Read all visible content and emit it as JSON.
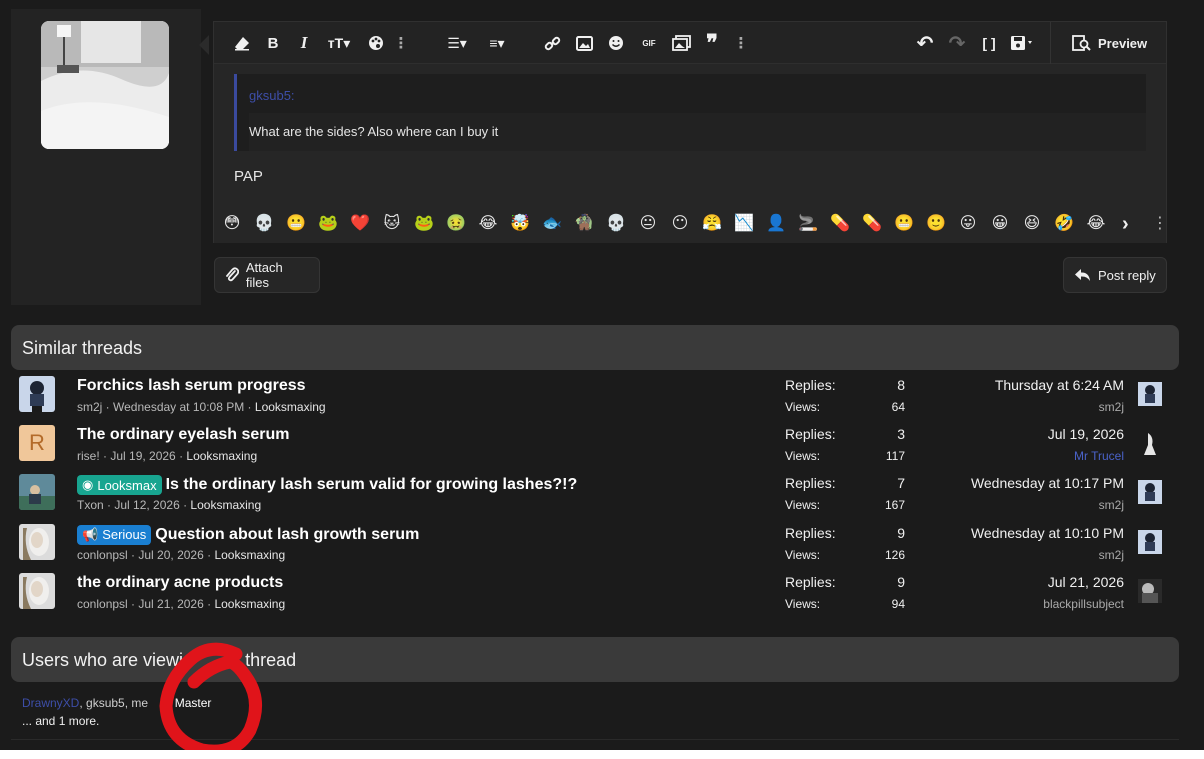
{
  "editor": {
    "quote_author": "gksub5:",
    "quote_text": "What are the sides? Also where can I buy it",
    "body_text": "PAP",
    "preview_label": "Preview",
    "attach_label": "Attach files",
    "post_reply_label": "Post reply",
    "toolbar_left": [
      {
        "icon": "eraser-icon",
        "glyph": "⌫"
      },
      {
        "icon": "bold-icon",
        "glyph": "B"
      },
      {
        "icon": "italic-icon",
        "glyph": "I"
      },
      {
        "icon": "text-size-icon",
        "glyph": "тT"
      },
      {
        "icon": "palette-icon",
        "glyph": "◕"
      },
      {
        "icon": "more-vertical-icon",
        "glyph": "⋮"
      },
      {
        "icon": "list-icon",
        "glyph": "☰"
      },
      {
        "icon": "align-icon",
        "glyph": "≡"
      },
      {
        "icon": "link-icon",
        "glyph": "🔗"
      },
      {
        "icon": "image-icon",
        "glyph": "▣"
      },
      {
        "icon": "smiley-icon",
        "glyph": "☺"
      },
      {
        "icon": "gif-icon",
        "glyph": "GIF"
      },
      {
        "icon": "media-icon",
        "glyph": "▦"
      },
      {
        "icon": "quote-icon",
        "glyph": "❞"
      },
      {
        "icon": "more-vertical-icon-2",
        "glyph": "⋮"
      }
    ],
    "toolbar_right": [
      {
        "icon": "undo-icon",
        "glyph": "↶"
      },
      {
        "icon": "redo-icon",
        "glyph": "↷"
      },
      {
        "icon": "bbcode-icon",
        "glyph": "[ ]"
      },
      {
        "icon": "save-draft-icon",
        "glyph": "▾"
      }
    ]
  },
  "smilies": [
    "😳",
    "💀",
    "😬",
    "🐸",
    "❤️",
    "🐱",
    "🐸",
    "🤢",
    "😂",
    "🤯",
    "🐟",
    "🧌",
    "💀",
    "😐",
    "😶",
    "😤",
    "📉",
    "👤",
    "🚬",
    "💊",
    "💊",
    "😬",
    "🙂",
    "😛",
    "😀",
    "😆",
    "🤣",
    "😂"
  ],
  "similar_threads": {
    "title": "Similar threads",
    "replies_label": "Replies:",
    "views_label": "Views:",
    "rows": [
      {
        "title": "Forchics lash serum progress",
        "label": "",
        "author": "sm2j",
        "date": "Wednesday at 10:08 PM",
        "forum": "Looksmaxing",
        "replies": "8",
        "views": "64",
        "last_date": "Thursday at 6:24 AM",
        "last_user": "sm2j",
        "avatar": "figure"
      },
      {
        "title": "The ordinary eyelash serum",
        "label": "",
        "author": "rise!",
        "date": "Jul 19, 2026",
        "forum": "Looksmaxing",
        "replies": "3",
        "views": "117",
        "last_date": "Jul 19, 2026",
        "last_user": "Mr Trucel",
        "avatar": "letter",
        "avatar_letter": "R"
      },
      {
        "title": "Is the ordinary lash serum valid for growing lashes?!?",
        "label": "Looksmax",
        "author": "Txon",
        "date": "Jul 12, 2026",
        "forum": "Looksmaxing",
        "replies": "7",
        "views": "167",
        "last_date": "Wednesday at 10:17 PM",
        "last_user": "sm2j",
        "avatar": "photo"
      },
      {
        "title": "Question about lash growth serum",
        "label": "Serious",
        "author": "conlonpsl",
        "date": "Jul 20, 2026",
        "forum": "Looksmaxing",
        "replies": "9",
        "views": "126",
        "last_date": "Wednesday at 10:10 PM",
        "last_user": "sm2j",
        "avatar": "face"
      },
      {
        "title": "the ordinary acne products",
        "label": "",
        "author": "conlonpsl",
        "date": "Jul 21, 2026",
        "forum": "Looksmaxing",
        "replies": "9",
        "views": "94",
        "last_date": "Jul 21, 2026",
        "last_user": "blackpillsubject",
        "avatar": "face"
      }
    ]
  },
  "viewers": {
    "title_left": "Users who are viewi",
    "title_right": "thread",
    "users": [
      "DrawnyXD",
      "gksub5",
      "me",
      "Master"
    ],
    "more": "... and 1 more."
  },
  "colors": {
    "accent_blue": "#3d4ea8",
    "looksmax_label": "#18a590",
    "serious_label": "#1a7fd1",
    "annotation_red": "#e0141a"
  }
}
